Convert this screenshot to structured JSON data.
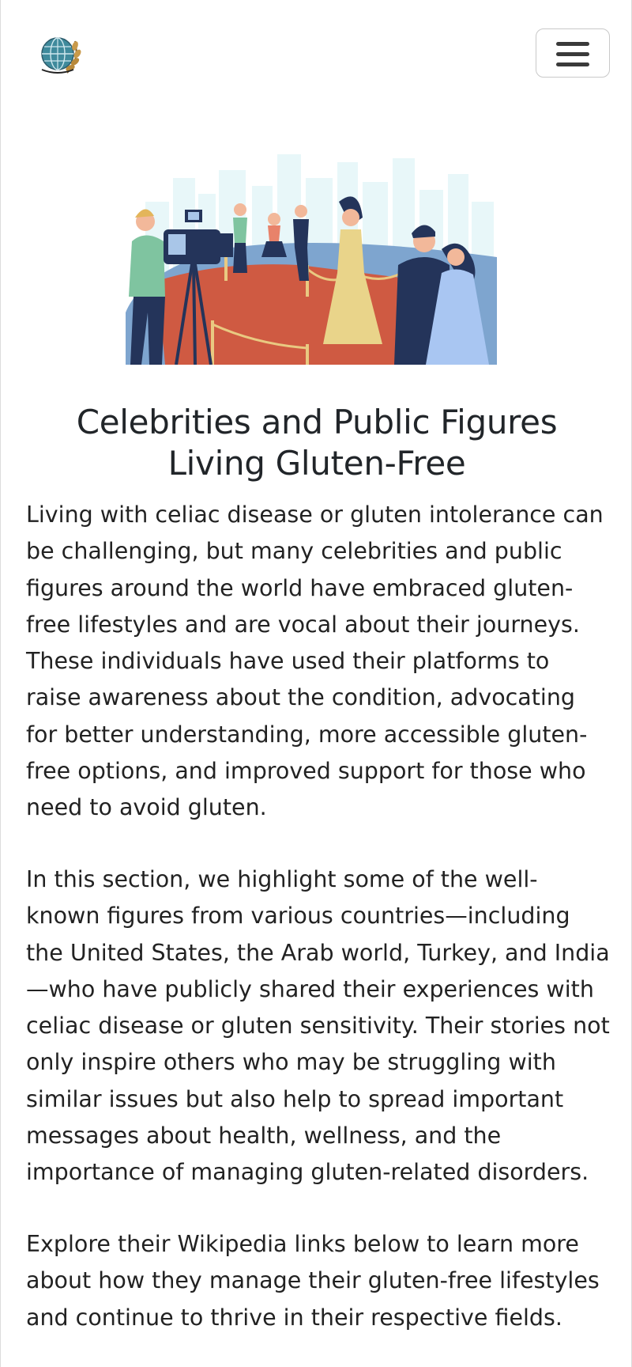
{
  "navbar": {
    "logo_icon": "globe-wheat-logo-icon",
    "menu_icon": "hamburger-menu-icon"
  },
  "hero": {
    "image_icon": "red-carpet-celebrities-illustration"
  },
  "content": {
    "title": "Celebrities and Public Figures Living Gluten-Free",
    "paragraphs": [
      "Living with celiac disease or gluten intolerance can be challenging, but many celebrities and public figures around the world have embraced gluten-free lifestyles and are vocal about their journeys. These individuals have used their platforms to raise awareness about the condition, advocating for better understanding, more accessible gluten-free options, and improved support for those who need to avoid gluten.",
      "In this section, we highlight some of the well-known figures from various countries—including the United States, the Arab world, Turkey, and India—who have publicly shared their experiences with celiac disease or gluten sensitivity. Their stories not only inspire others who may be struggling with similar issues but also help to spread important messages about health, wellness, and the importance of managing gluten-related disorders.",
      "Explore their Wikipedia links below to learn more about how they manage their gluten-free lifestyles and continue to thrive in their respective fields."
    ]
  },
  "colors": {
    "red_carpet": "#cf5a42",
    "navy": "#24345a",
    "sky": "#e6f6f8",
    "gold": "#e9c981",
    "mint": "#7fc4a0"
  }
}
